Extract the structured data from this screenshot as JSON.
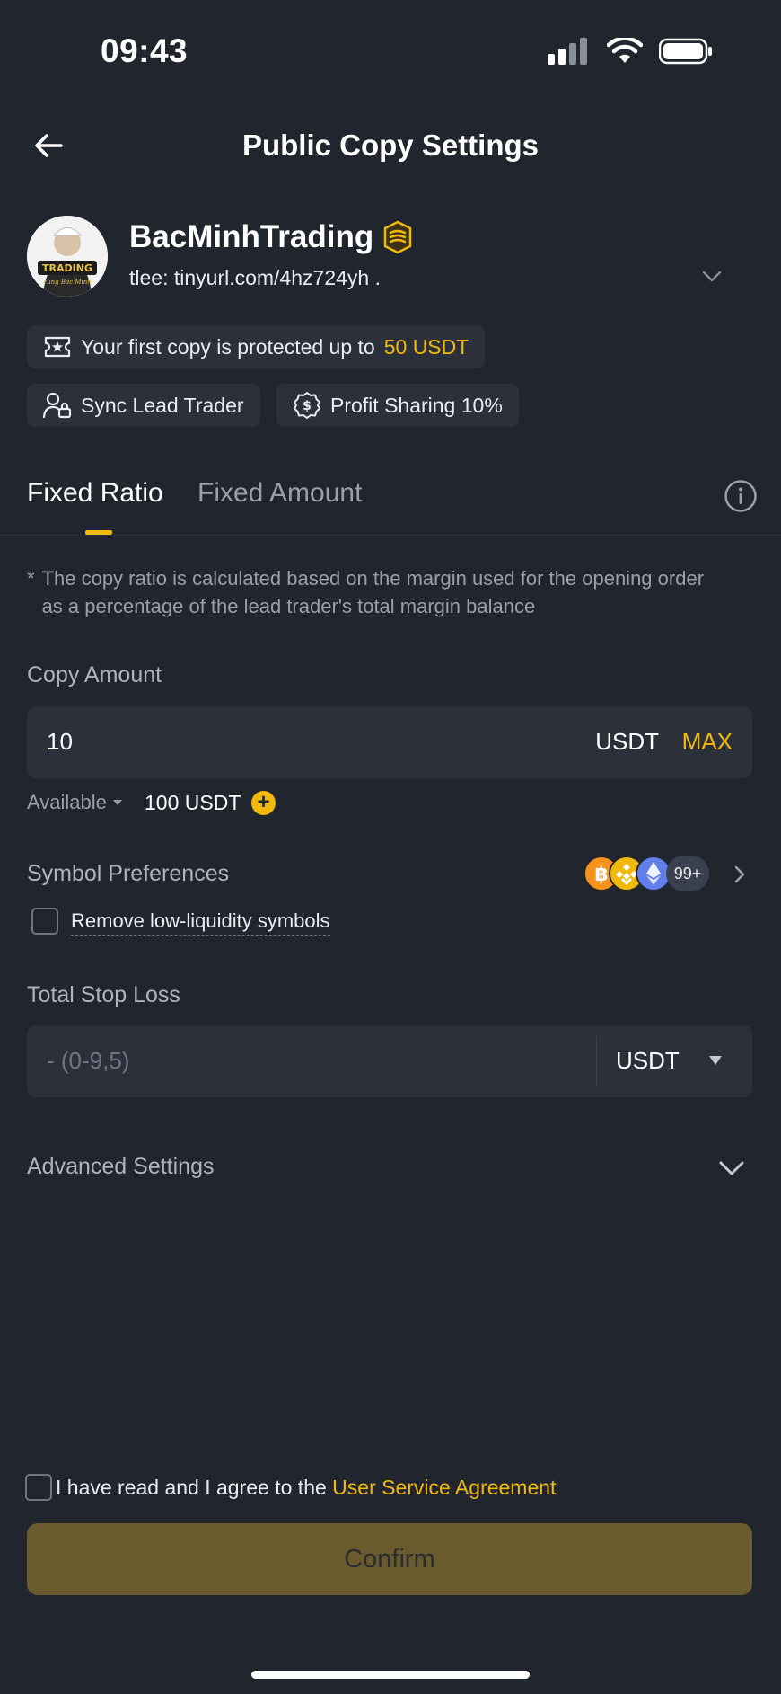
{
  "status_bar": {
    "time": "09:43"
  },
  "header": {
    "title": "Public Copy Settings"
  },
  "profile": {
    "name": "BacMinhTrading",
    "subtitle": "tlee: tinyurl.com/4hz724yh .",
    "avatar_text_top": "TRADING",
    "avatar_text_bottom": "cùng Bác Minh"
  },
  "chips": {
    "protect_prefix": "Your first copy is protected up to",
    "protect_amount": "50 USDT",
    "sync": "Sync Lead Trader",
    "profit": "Profit Sharing 10%"
  },
  "tabs": {
    "active": "Fixed Ratio",
    "inactive": "Fixed Amount"
  },
  "note": {
    "marker": "*",
    "text": "The copy ratio is calculated based on the margin used for the opening order as a percentage of the lead trader's total margin balance"
  },
  "copy_amount": {
    "label": "Copy Amount",
    "value": "10",
    "unit": "USDT",
    "max_label": "MAX"
  },
  "available": {
    "label": "Available",
    "value": "100 USDT",
    "plus": "+"
  },
  "symbols": {
    "label": "Symbol Preferences",
    "more_count": "99+",
    "remove_low_liquidity": "Remove low-liquidity symbols"
  },
  "stop_loss": {
    "label": "Total Stop Loss",
    "placeholder": "- (0-9,5)",
    "unit": "USDT"
  },
  "advanced": {
    "label": "Advanced Settings"
  },
  "agreement": {
    "prefix": "I have read and I agree to the",
    "link": "User Service Agreement"
  },
  "confirm": {
    "label": "Confirm"
  },
  "colors": {
    "background": "#21252e",
    "card": "#2b303b",
    "accent": "#f0b90b",
    "confirm_disabled": "#695b2d",
    "muted_text": "#9aa0ab"
  }
}
